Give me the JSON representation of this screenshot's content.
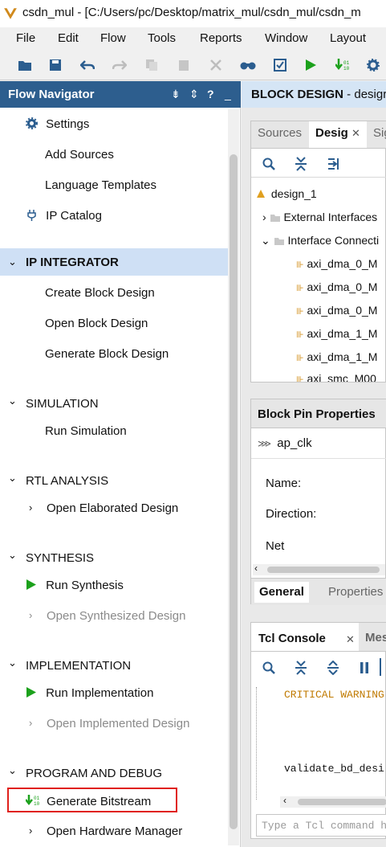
{
  "window": {
    "title": "csdn_mul - [C:/Users/pc/Desktop/matrix_mul/csdn_mul/csdn_m"
  },
  "menu": [
    "File",
    "Edit",
    "Flow",
    "Tools",
    "Reports",
    "Window",
    "Layout"
  ],
  "flow_navigator": {
    "title": "Flow Navigator",
    "top_items": [
      "Settings",
      "Add Sources",
      "Language Templates",
      "IP Catalog"
    ],
    "sections": {
      "ip_integrator": {
        "title": "IP INTEGRATOR",
        "items": [
          "Create Block Design",
          "Open Block Design",
          "Generate Block Design"
        ]
      },
      "simulation": {
        "title": "SIMULATION",
        "items": [
          "Run Simulation"
        ]
      },
      "rtl_analysis": {
        "title": "RTL ANALYSIS",
        "items": [
          "Open Elaborated Design"
        ]
      },
      "synthesis": {
        "title": "SYNTHESIS",
        "items": [
          "Run Synthesis",
          "Open Synthesized Design"
        ]
      },
      "implementation": {
        "title": "IMPLEMENTATION",
        "items": [
          "Run Implementation",
          "Open Implemented Design"
        ]
      },
      "program_debug": {
        "title": "PROGRAM AND DEBUG",
        "items": [
          "Generate Bitstream",
          "Open Hardware Manager"
        ]
      }
    }
  },
  "block_design": {
    "title": "BLOCK DESIGN",
    "subtitle": " - desigr",
    "tabs": [
      "Sources",
      "Desig",
      "Sig"
    ],
    "tree": {
      "root": "design_1",
      "nodes": [
        "External Interfaces",
        "Interface Connecti"
      ],
      "children": [
        "axi_dma_0_M",
        "axi_dma_0_M",
        "axi_dma_0_M",
        "axi_dma_1_M",
        "axi_dma_1_M",
        "axi_smc_M00"
      ]
    }
  },
  "block_pin": {
    "title": "Block Pin Properties",
    "pin": "ap_clk",
    "fields": [
      "Name:",
      "Direction:",
      "Net"
    ],
    "tabs": [
      "General",
      "Properties"
    ]
  },
  "tcl": {
    "tabs": [
      "Tcl Console",
      "Mes"
    ],
    "lines": [
      "CRITICAL WARNING",
      "validate_bd_desi"
    ],
    "input_placeholder": "Type a Tcl command h"
  },
  "colors": {
    "nav_header": "#2d5e8e",
    "selected": "#cfe0f5",
    "run_green": "#1ca11c",
    "highlight_red": "#e0201a"
  }
}
